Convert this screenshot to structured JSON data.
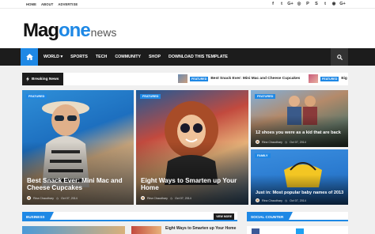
{
  "topbar": {
    "links": [
      "HOME",
      "ABOUT",
      "ADVERTISE"
    ],
    "social_icons": [
      "facebook-icon",
      "twitter-icon",
      "google-plus-icon",
      "instagram-icon",
      "pinterest-icon",
      "skype-icon",
      "tumblr-icon",
      "dribbble-icon",
      "google-plus-alt-icon"
    ],
    "social_glyphs": [
      "f",
      "t",
      "G+",
      "◎",
      "P",
      "S",
      "t",
      "◉",
      "G+"
    ]
  },
  "logo": {
    "mag": "Mag",
    "one": "one",
    "news": "news"
  },
  "nav": {
    "items": [
      "WORLD ▾",
      "SPORTS",
      "TECH",
      "COMMUNITY",
      "SHOP",
      "DOWNLOAD THIS TEMPLATE"
    ]
  },
  "breaking": {
    "label": "Breaking News",
    "items": [
      {
        "tag": "FEATURED",
        "title": "Best Snack Ever: Mini Mac and Cheese Cupcakes"
      },
      {
        "tag": "FEATURED",
        "title": "Eig"
      }
    ]
  },
  "features": [
    {
      "tag": "FEATURED",
      "title": "Best Snack Ever: Mini Mac and Cheese Cupcakes",
      "author": "Rina Chaudhary",
      "date": "Oct 07, 2014"
    },
    {
      "tag": "FEATURED",
      "title": "Eight Ways to Smarten up Your Home",
      "author": "Rina Chaudhary",
      "date": "Oct 07, 2014"
    },
    {
      "tag": "FEATURED",
      "title": "12 shoes you were as a kid that are back",
      "author": "Rina Chaudhary",
      "date": "Oct 07, 2014"
    },
    {
      "tag": "FAMILY",
      "title": "Just in: Most popular baby names of 2013",
      "author": "Rina Chaudhary",
      "date": "Oct 07, 2014"
    }
  ],
  "sections": {
    "business": {
      "label": "BUSINESS",
      "view_more": "VIEW MORE",
      "item_title": "Eight Ways to Smarten up Your Home"
    },
    "social": {
      "label": "SOCIAL COUNTER"
    }
  },
  "colors": {
    "accent": "#1e88e5",
    "dark": "#1c1c1c"
  }
}
